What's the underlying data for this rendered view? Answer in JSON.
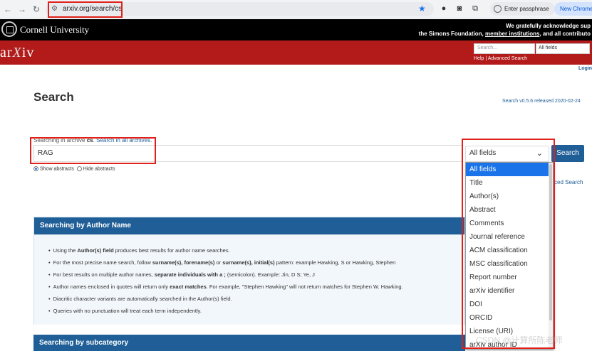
{
  "browser": {
    "back": "←",
    "forward": "→",
    "reload": "↻",
    "url": "arxiv.org/search/cs",
    "passkey_label": "Enter passphrase",
    "new_chrome_label": "New Chrome"
  },
  "cornell": {
    "name": "Cornell University",
    "ack_line1": "We gratefully acknowledge sup",
    "ack_line2_pre": "the Simons Foundation, ",
    "ack_link": "member institutions",
    "ack_line2_post": ", and all contributo"
  },
  "arxiv": {
    "logo_a": "ar",
    "logo_x": "X",
    "logo_b": "iv",
    "search_placeholder": "Search...",
    "field_default": "All fields",
    "help_links": "Help | Advanced Search",
    "login": "Login"
  },
  "main": {
    "title": "Search",
    "version": "Search v0.5.6 released 2020-02-24",
    "searching_prefix": "Searching in archive ",
    "archive": "cs",
    "searching_suffix": ". ",
    "search_all_link": "Search in all archives.",
    "query_value": "RAG",
    "field_selected": "All fields",
    "search_button": "Search",
    "show_abstracts": "Show abstracts",
    "hide_abstracts": "Hide abstracts",
    "advanced_search_partial": "ced Search"
  },
  "dropdown": {
    "options": [
      "All fields",
      "Title",
      "Author(s)",
      "Abstract",
      "Comments",
      "Journal reference",
      "ACM classification",
      "MSC classification",
      "Report number",
      "arXiv identifier",
      "DOI",
      "ORCID",
      "License (URI)",
      "arXiv author ID"
    ]
  },
  "author_box": {
    "heading": "Searching by Author Name",
    "tips": [
      {
        "pre": "Using the ",
        "bold": "Author(s) field",
        "post": " produces best results for author name searches."
      },
      {
        "pre": "For the most precise name search, follow ",
        "bold": "surname(s), forename(s)",
        "mid": " or ",
        "bold2": "surname(s), initial(s)",
        "post": " pattern: example Hawking, S or Hawking, Stephen"
      },
      {
        "pre": "For best results on multiple author names, ",
        "bold": "separate individuals with a ;",
        "post": " (semicolon). Example: Jin, D S; Ye, J"
      },
      {
        "pre": "Author names enclosed in quotes will return only ",
        "bold": "exact matches",
        "post": ". For example, \"Stephen Hawking\" will not return matches for Stephen W. Hawking."
      },
      {
        "pre": "Diacritic character variants are automatically searched in the Author(s) field.",
        "bold": "",
        "post": ""
      },
      {
        "pre": "Queries with no punctuation will treat each term independently.",
        "bold": "",
        "post": ""
      }
    ]
  },
  "subcategory_box": {
    "heading": "Searching by subcategory"
  },
  "watermark": "CSDN @计算所陈老师",
  "colors": {
    "arxiv_red": "#b31b1b",
    "arxiv_blue": "#1f5e96",
    "annotation_red": "#e0201a",
    "dropdown_highlight": "#1a73e8"
  },
  "icons": [
    "back-icon",
    "forward-icon",
    "reload-icon",
    "site-info-icon",
    "bookmark-star-icon",
    "extension-icon",
    "camera-icon",
    "puzzle-icon",
    "cornell-seal-icon",
    "chevron-down-icon"
  ]
}
